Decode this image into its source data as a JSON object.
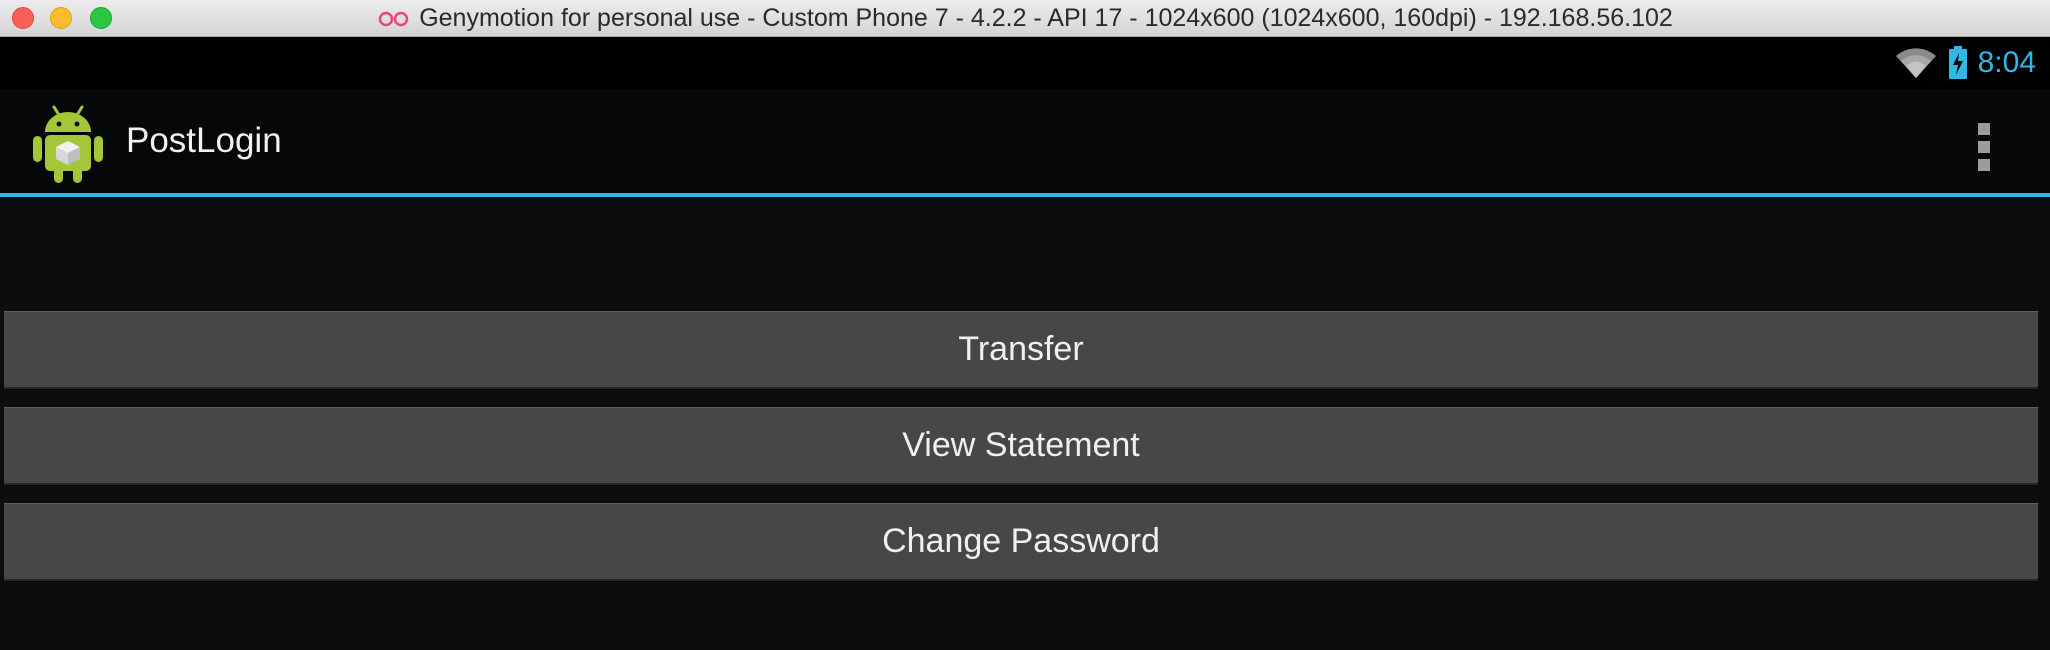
{
  "window": {
    "title": "Genymotion for personal use - Custom Phone 7 - 4.2.2 - API 17 - 1024x600 (1024x600, 160dpi) - 192.168.56.102"
  },
  "status_bar": {
    "time": "8:04",
    "icons": [
      "wifi-icon",
      "battery-charging-icon"
    ],
    "accent_color": "#33b5e5"
  },
  "action_bar": {
    "title": "PostLogin",
    "app_icon": "android-robot-icon",
    "menu_icon": "overflow-menu-icon",
    "divider_color": "#33b5e5"
  },
  "buttons": [
    {
      "label": "Transfer"
    },
    {
      "label": "View Statement"
    },
    {
      "label": "Change Password"
    }
  ]
}
